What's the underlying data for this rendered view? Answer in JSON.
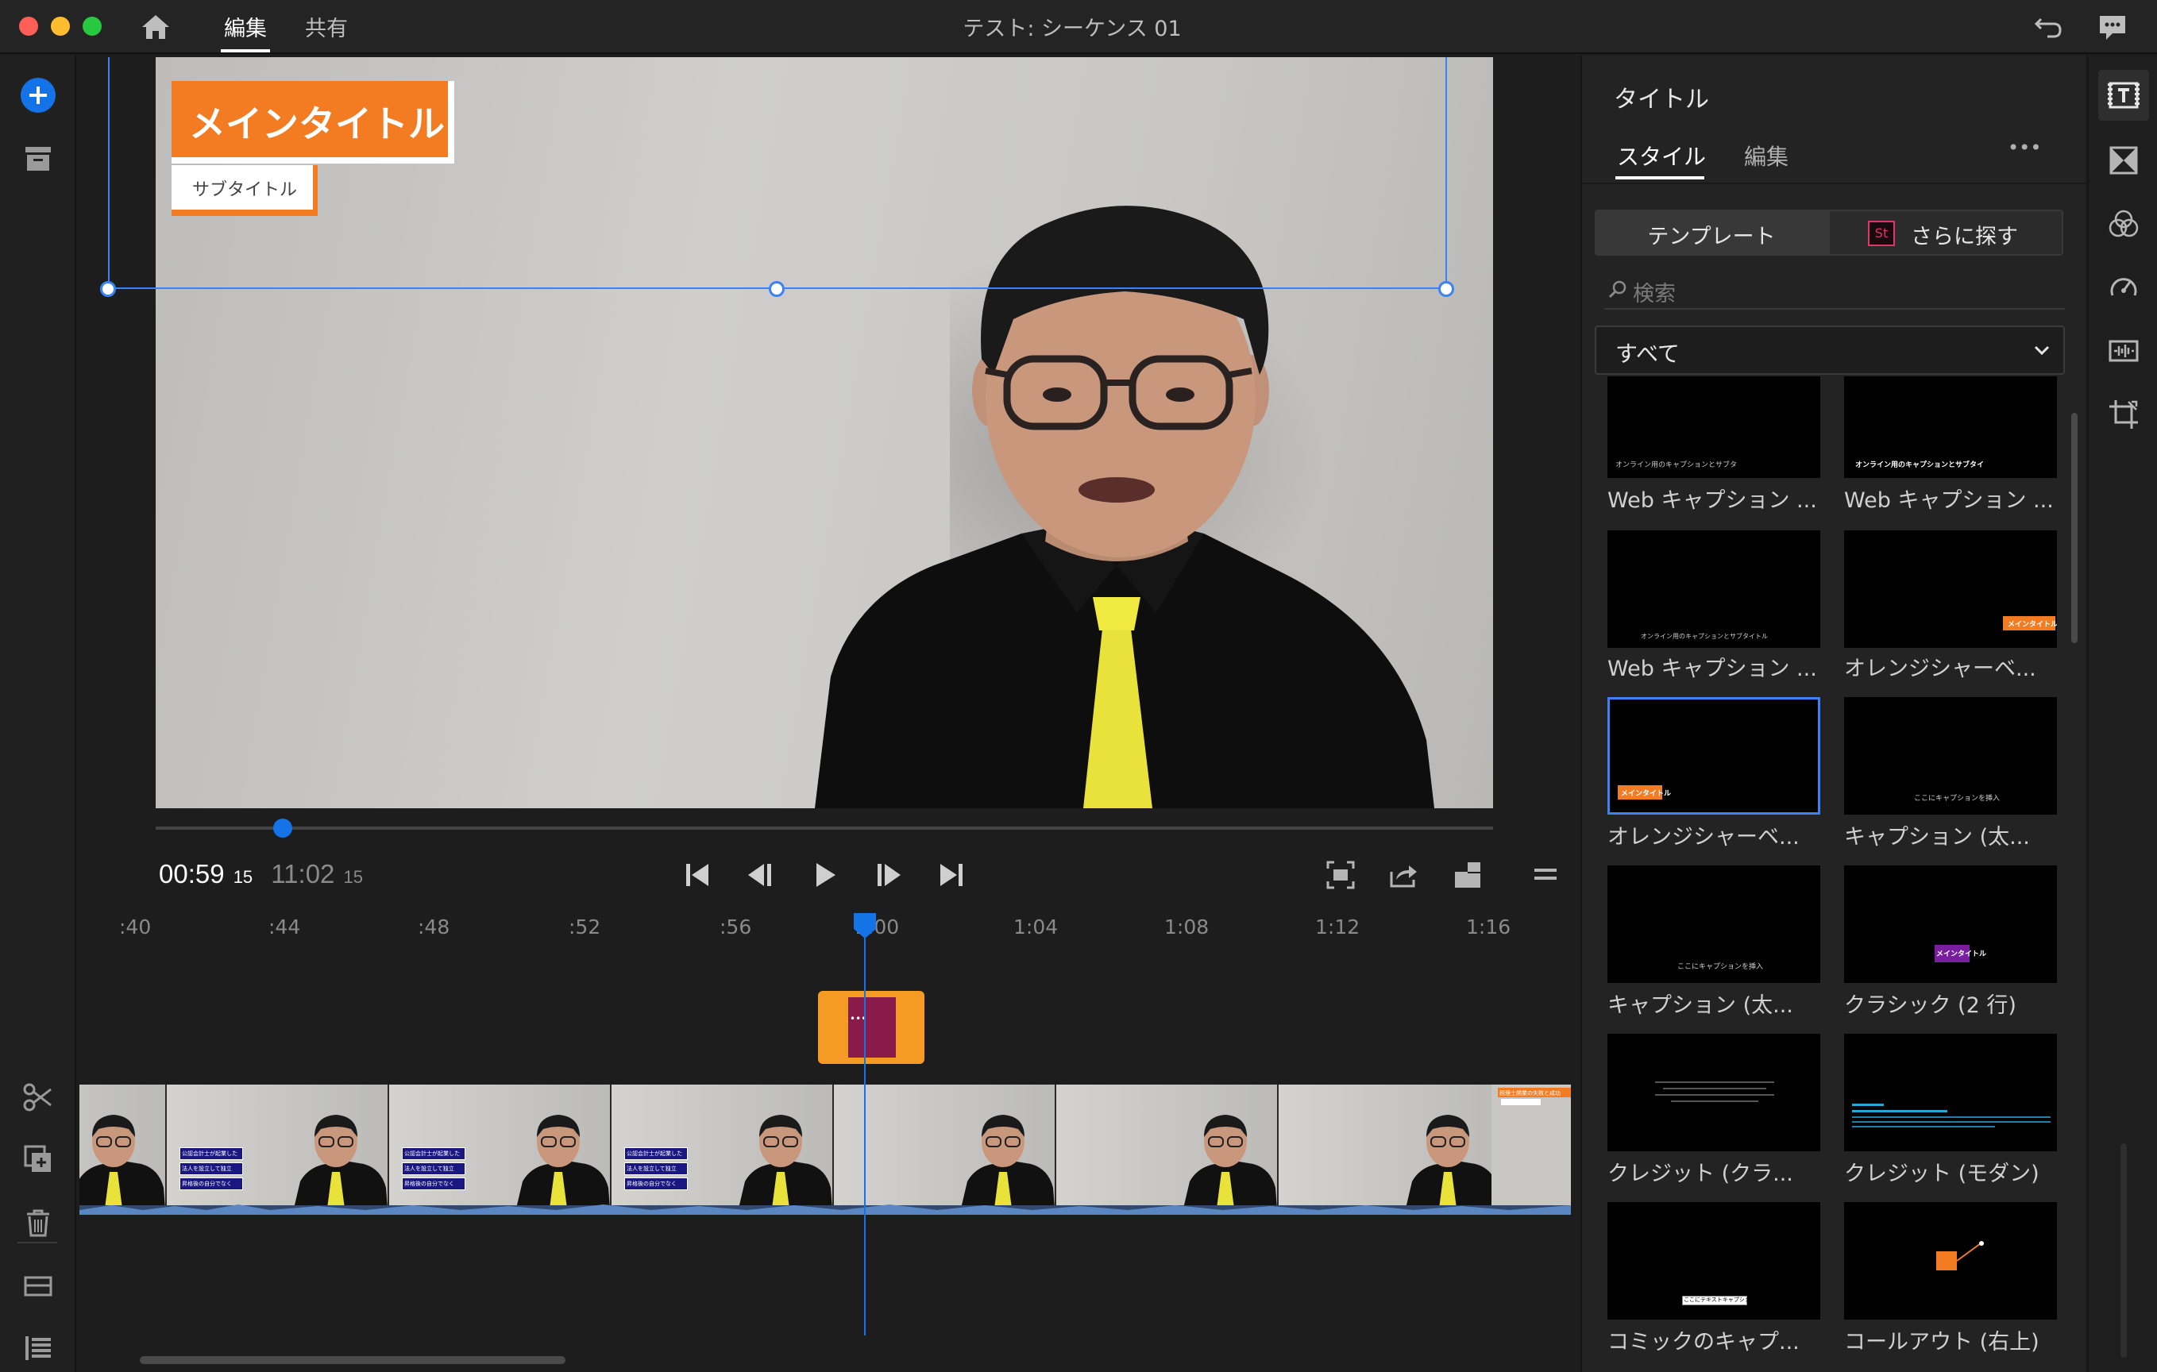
{
  "titlebar": {
    "tabs": [
      "編集",
      "共有"
    ],
    "sequence_title": "テスト: シーケンス 01"
  },
  "preview": {
    "main_title": "メインタイトル",
    "sub_title": "サブタイトル"
  },
  "transport": {
    "current_time": "00:59",
    "current_frames": "15",
    "duration_time": "11:02",
    "duration_frames": "15",
    "playhead_fraction": 0.095
  },
  "timeline": {
    "ruler": [
      ":40",
      ":44",
      ":48",
      ":52",
      ":56",
      "1:00",
      "1:04",
      "1:08",
      "1:12",
      "1:16"
    ],
    "title_clip_label": "•••",
    "frame_caption_lines": [
      "公認会計士が起業した",
      "法人を設立して独立",
      "昇格後の自分でなく"
    ],
    "last_frame_caption": "税理士開業の失敗と成功"
  },
  "panel": {
    "header": "タイトル",
    "tabs": [
      "スタイル",
      "編集"
    ],
    "more": "•••",
    "segment_templates": "テンプレート",
    "segment_more": "さらに探す",
    "stock_badge": "St",
    "search_placeholder": "検索",
    "filter_value": "すべて",
    "templates": [
      {
        "label": "Web キャプション ...",
        "inner": "オンライン用のキャプションとサブタ"
      },
      {
        "label": "Web キャプション ...",
        "inner": "オンライン用のキャプションとサブタイ"
      },
      {
        "label": "Web キャプション ...",
        "inner": "オンライン用のキャプションとサブタイトル"
      },
      {
        "label": "オレンジシャーベ...",
        "inner": "メインタイトル"
      },
      {
        "label": "オレンジシャーベ...",
        "inner": "メインタイトル"
      },
      {
        "label": "キャプション (太...",
        "inner": "ここにキャプションを挿入"
      },
      {
        "label": "キャプション (太...",
        "inner": "ここにキャプションを挿入"
      },
      {
        "label": "クラシック (2 行)",
        "inner": "メインタイトル"
      },
      {
        "label": "クレジット (クラ...",
        "inner": ""
      },
      {
        "label": "クレジット (モダン)",
        "inner": ""
      },
      {
        "label": "コミックのキャプ...",
        "inner": "ここにテキストキャプションを挿入"
      },
      {
        "label": "コールアウト (右上)",
        "inner": ""
      }
    ]
  },
  "colors": {
    "accent_blue": "#1473e6",
    "orange": "#f37c22",
    "clip_orange": "#f59a23",
    "clip_magenta": "#8a1a4a",
    "selection_blue": "#3b82f6"
  }
}
